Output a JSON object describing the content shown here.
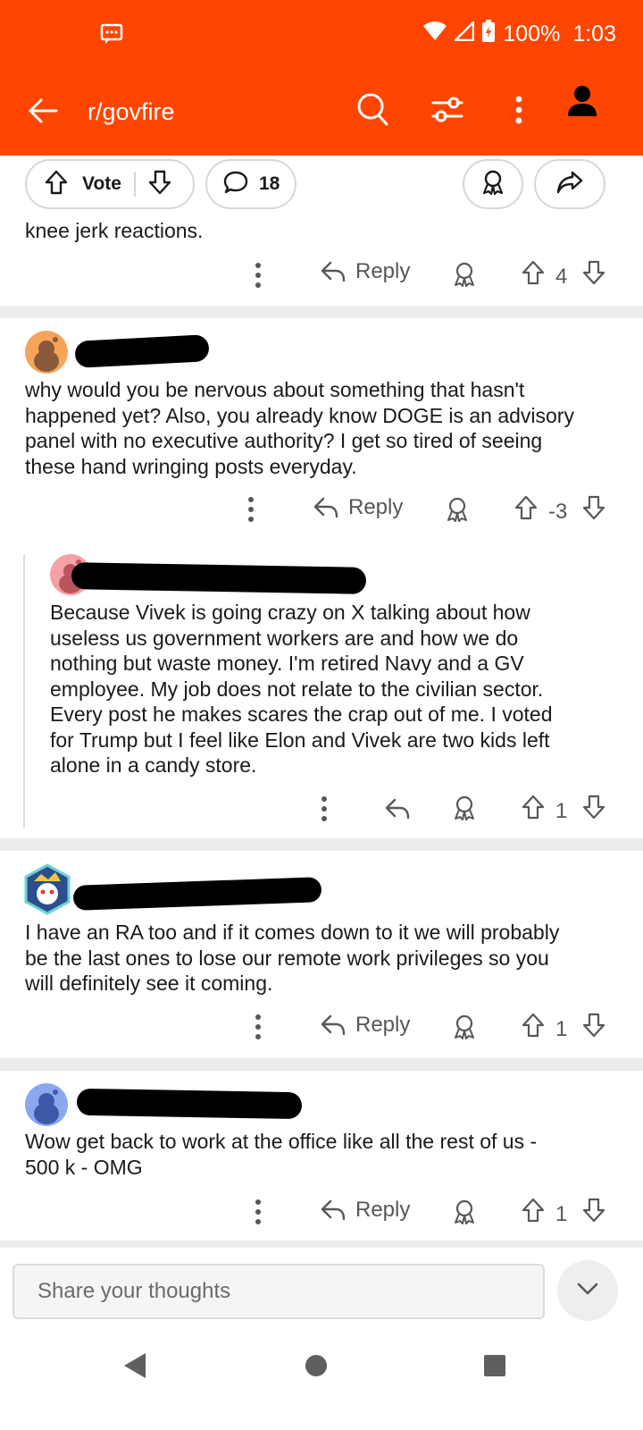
{
  "status_bar": {
    "battery": "100%",
    "time": "1:03"
  },
  "app_bar": {
    "title": "r/govfire"
  },
  "post_actions": {
    "vote_label": "Vote",
    "comment_count": "18"
  },
  "comments": [
    {
      "text": "knee jerk reactions.",
      "reply_label": "Reply",
      "score": "4"
    },
    {
      "text_lines": [
        "why would you be nervous about something that hasn't",
        "happened yet? Also, you already know DOGE is an advisory",
        "panel with no executive authority? I get so tired of seeing",
        "these hand wringing posts everyday."
      ],
      "reply_label": "Reply",
      "score": "-3"
    },
    {
      "text_lines": [
        "Because Vivek is going crazy on X talking about how",
        "useless us government workers are and how we do",
        "nothing but waste money. I'm retired Navy and a GV",
        "employee. My job does not relate to the civilian sector.",
        "Every post he makes scares the crap out of me. I voted",
        "for Trump but I feel like Elon and Vivek are two kids left",
        "alone in a candy store."
      ],
      "score": "1"
    },
    {
      "text_lines": [
        "I have an RA too and if it comes down to it we will probably",
        "be the last ones to lose our remote work privileges so you",
        "will definitely see it coming."
      ],
      "reply_label": "Reply",
      "score": "1"
    },
    {
      "text_lines": [
        "Wow get back to work at the office like all the rest of us -",
        "500 k - OMG"
      ],
      "reply_label": "Reply",
      "score": "1"
    }
  ],
  "composer": {
    "placeholder": "Share your thoughts"
  },
  "colors": {
    "brand": "#ff4500",
    "text": "#1a1a1b",
    "muted": "#575757"
  }
}
